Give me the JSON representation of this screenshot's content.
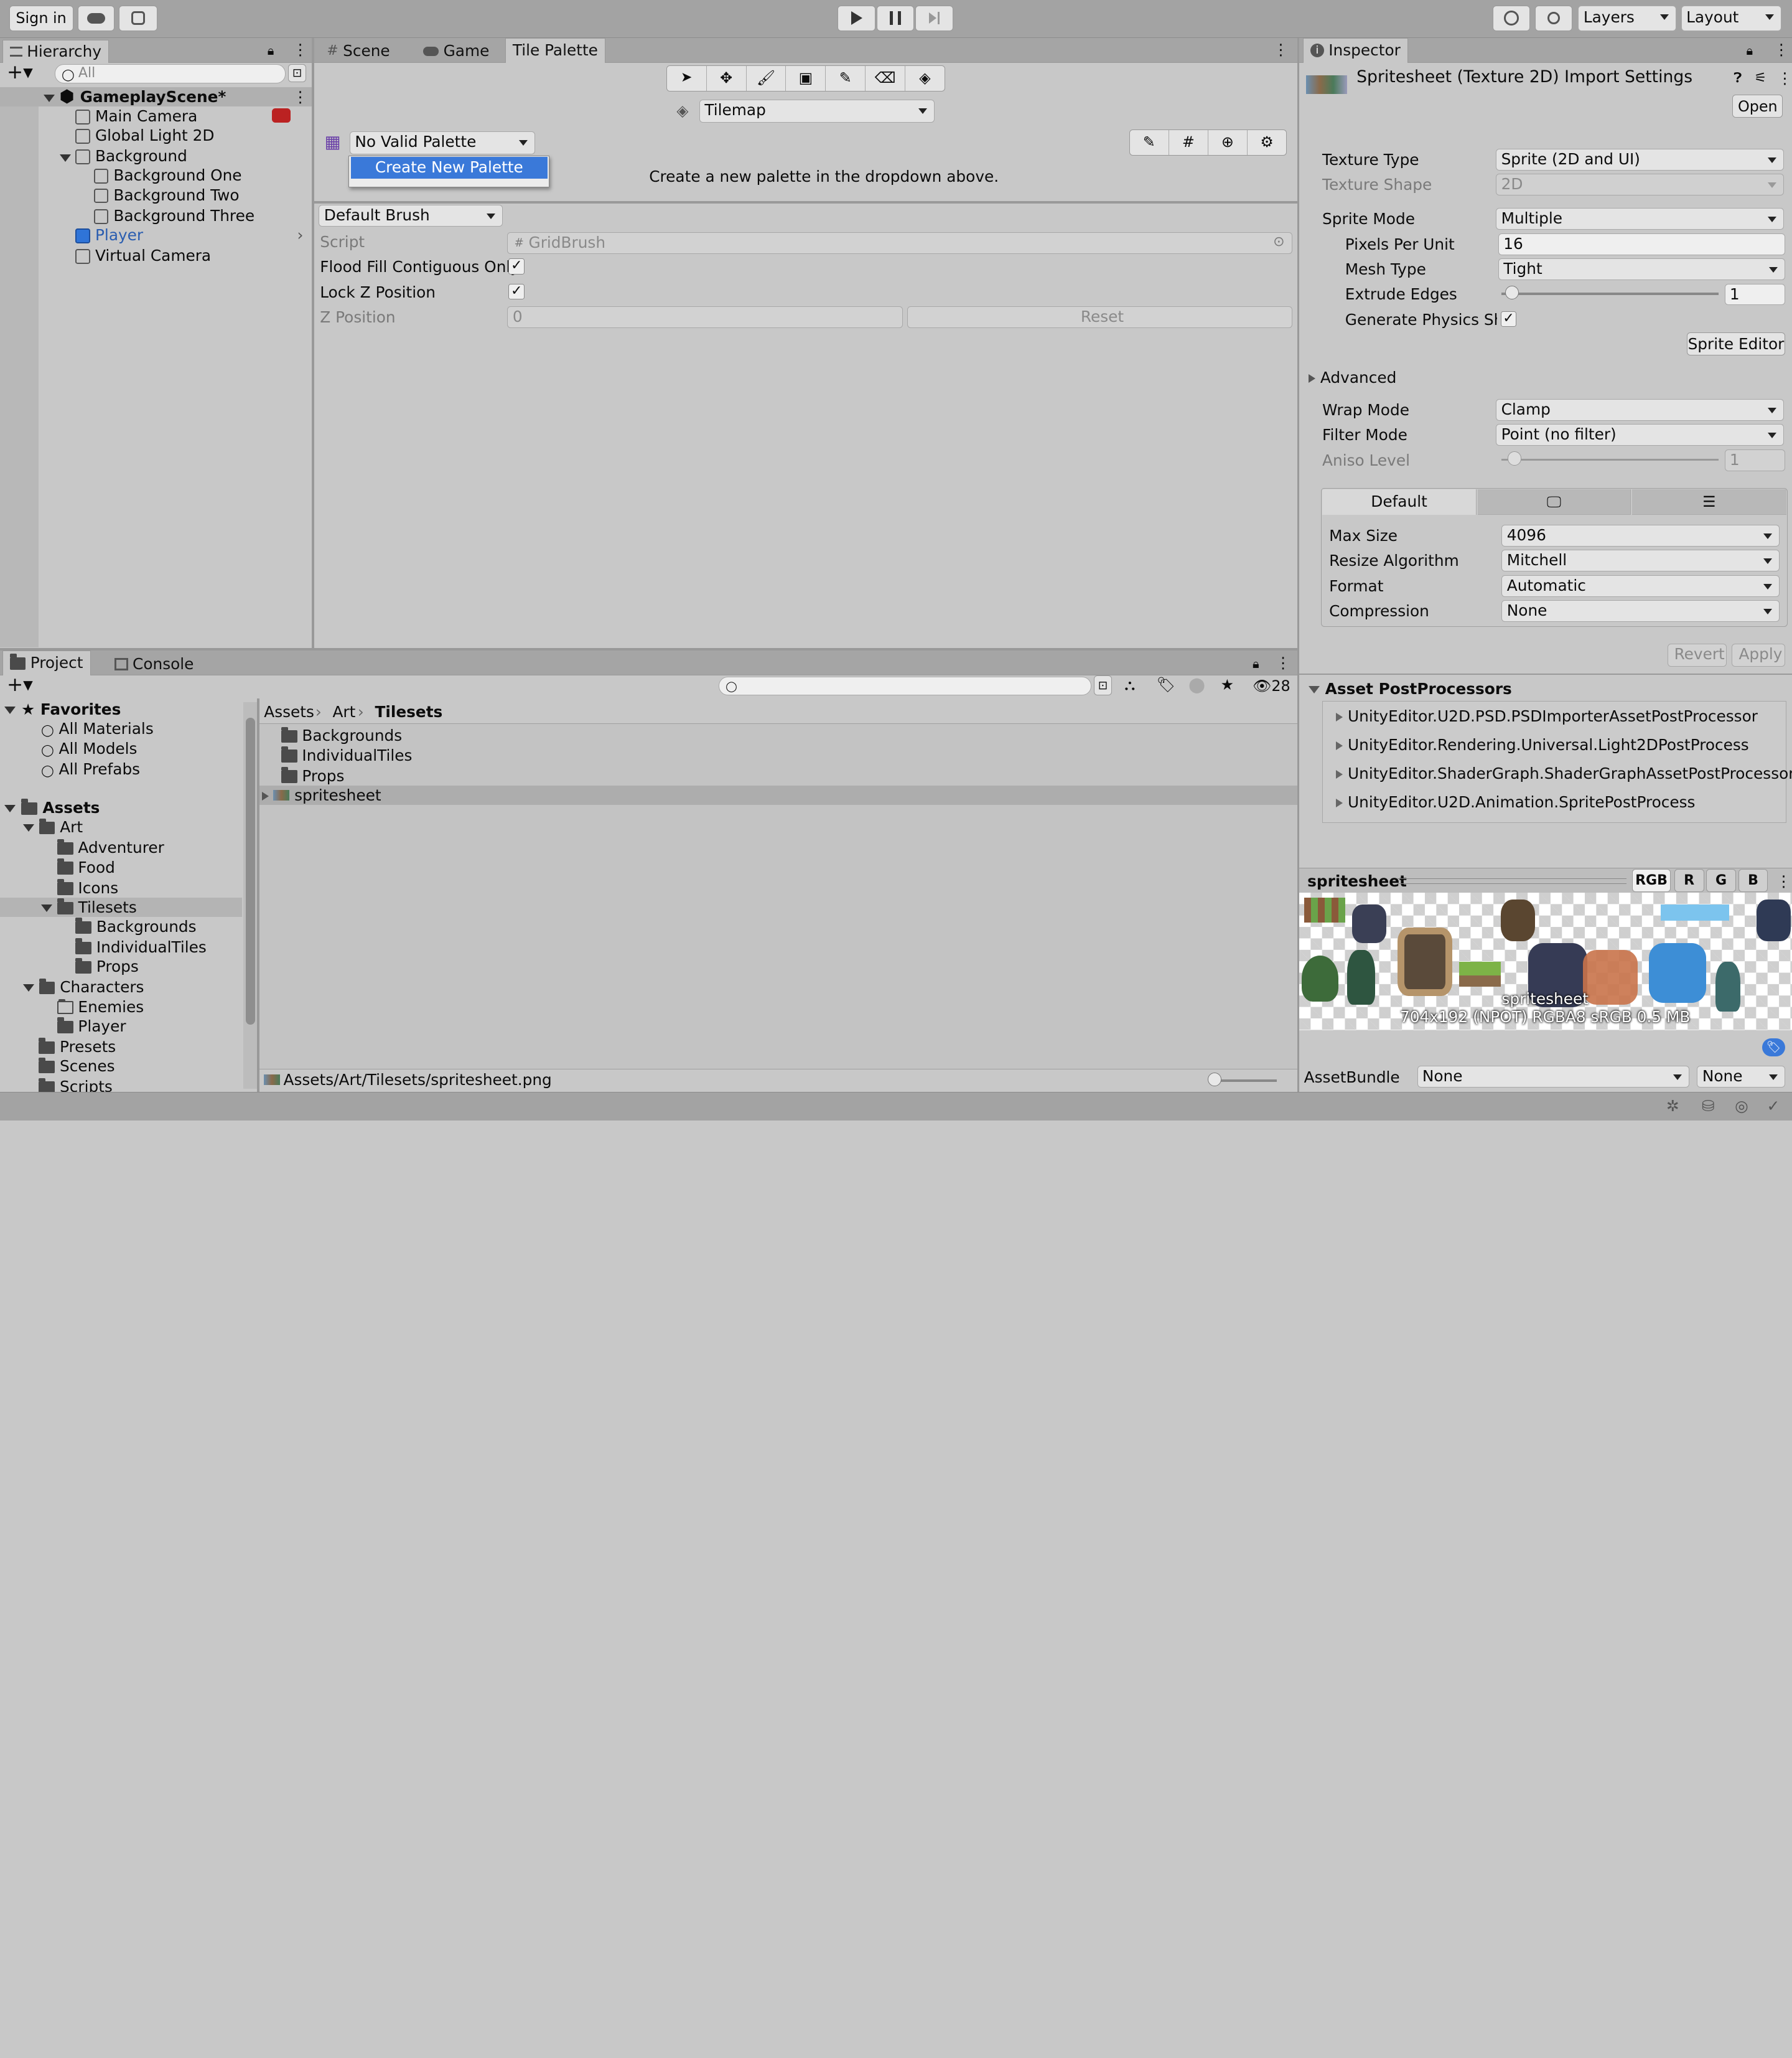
{
  "toolbar": {
    "sign_in": "Sign in",
    "layers": "Layers",
    "layout": "Layout"
  },
  "hierarchy": {
    "tab": "Hierarchy",
    "search_placeholder": "All",
    "scene": "GameplayScene*",
    "items": [
      "Main Camera",
      "Global Light 2D",
      "Background",
      "Background One",
      "Background Two",
      "Background Three",
      "Player",
      "Virtual Camera"
    ]
  },
  "center": {
    "tabs": [
      "Scene",
      "Game",
      "Tile Palette"
    ],
    "tilemap": "Tilemap",
    "palette": "No Valid Palette",
    "menu_item": "Create New Palette",
    "message": "Create a new palette in the dropdown above.",
    "brush": "Default Brush",
    "props": {
      "script_label": "Script",
      "script_value": "GridBrush",
      "flood_label": "Flood Fill Contiguous Only",
      "lockz_label": "Lock Z Position",
      "zpos_label": "Z Position",
      "zpos_value": "0",
      "reset": "Reset"
    }
  },
  "inspector": {
    "tab": "Inspector",
    "title": "Spritesheet (Texture 2D) Import Settings",
    "open": "Open",
    "rows": {
      "texture_type": {
        "label": "Texture Type",
        "value": "Sprite (2D and UI)"
      },
      "texture_shape": {
        "label": "Texture Shape",
        "value": "2D"
      },
      "sprite_mode": {
        "label": "Sprite Mode",
        "value": "Multiple"
      },
      "ppu": {
        "label": "Pixels Per Unit",
        "value": "16"
      },
      "mesh_type": {
        "label": "Mesh Type",
        "value": "Tight"
      },
      "extrude": {
        "label": "Extrude Edges",
        "value": "1"
      },
      "gen_physics": {
        "label": "Generate Physics Sha"
      },
      "wrap": {
        "label": "Wrap Mode",
        "value": "Clamp"
      },
      "filter": {
        "label": "Filter Mode",
        "value": "Point (no filter)"
      },
      "aniso": {
        "label": "Aniso Level",
        "value": "1"
      }
    },
    "sprite_editor": "Sprite Editor",
    "advanced": "Advanced",
    "platform_tab": "Default",
    "platform": {
      "max_size": {
        "label": "Max Size",
        "value": "4096"
      },
      "resize": {
        "label": "Resize Algorithm",
        "value": "Mitchell"
      },
      "format": {
        "label": "Format",
        "value": "Automatic"
      },
      "compression": {
        "label": "Compression",
        "value": "None"
      }
    },
    "revert": "Revert",
    "apply": "Apply",
    "postprocessors_title": "Asset PostProcessors",
    "postprocessors": [
      "UnityEditor.U2D.PSD.PSDImporterAssetPostProcessor",
      "UnityEditor.Rendering.Universal.Light2DPostProcess",
      "UnityEditor.ShaderGraph.ShaderGraphAssetPostProcessor",
      "UnityEditor.U2D.Animation.SpritePostProcess"
    ],
    "preview_title": "spritesheet",
    "channels": [
      "RGB",
      "R",
      "G",
      "B"
    ],
    "preview_name": "spritesheet",
    "preview_info": "704x192 (NPOT)  RGBA8 sRGB  0.5 MB",
    "assetbundle_label": "AssetBundle",
    "assetbundle_value": "None",
    "variant_value": "None"
  },
  "project": {
    "tabs": [
      "Project",
      "Console"
    ],
    "hidden_count": "28",
    "favorites": "Favorites",
    "fav_items": [
      "All Materials",
      "All Models",
      "All Prefabs"
    ],
    "tree": {
      "assets": "Assets",
      "art": "Art",
      "art_children": [
        "Adventurer",
        "Food",
        "Icons"
      ],
      "tilesets": "Tilesets",
      "tilesets_children": [
        "Backgrounds",
        "IndividualTiles",
        "Props"
      ],
      "characters": "Characters",
      "characters_children": [
        "Enemies",
        "Player"
      ],
      "rest": [
        "Presets",
        "Scenes",
        "Scripts"
      ]
    },
    "breadcrumb": [
      "Assets",
      "Art",
      "Tilesets"
    ],
    "files": [
      "Backgrounds",
      "IndividualTiles",
      "Props"
    ],
    "selected_file": "spritesheet",
    "path": "Assets/Art/Tilesets/spritesheet.png"
  },
  "colors": {
    "selection": "#3a79d9",
    "player_text": "#2a5db0",
    "panel_bg": "#c8c8c8"
  }
}
